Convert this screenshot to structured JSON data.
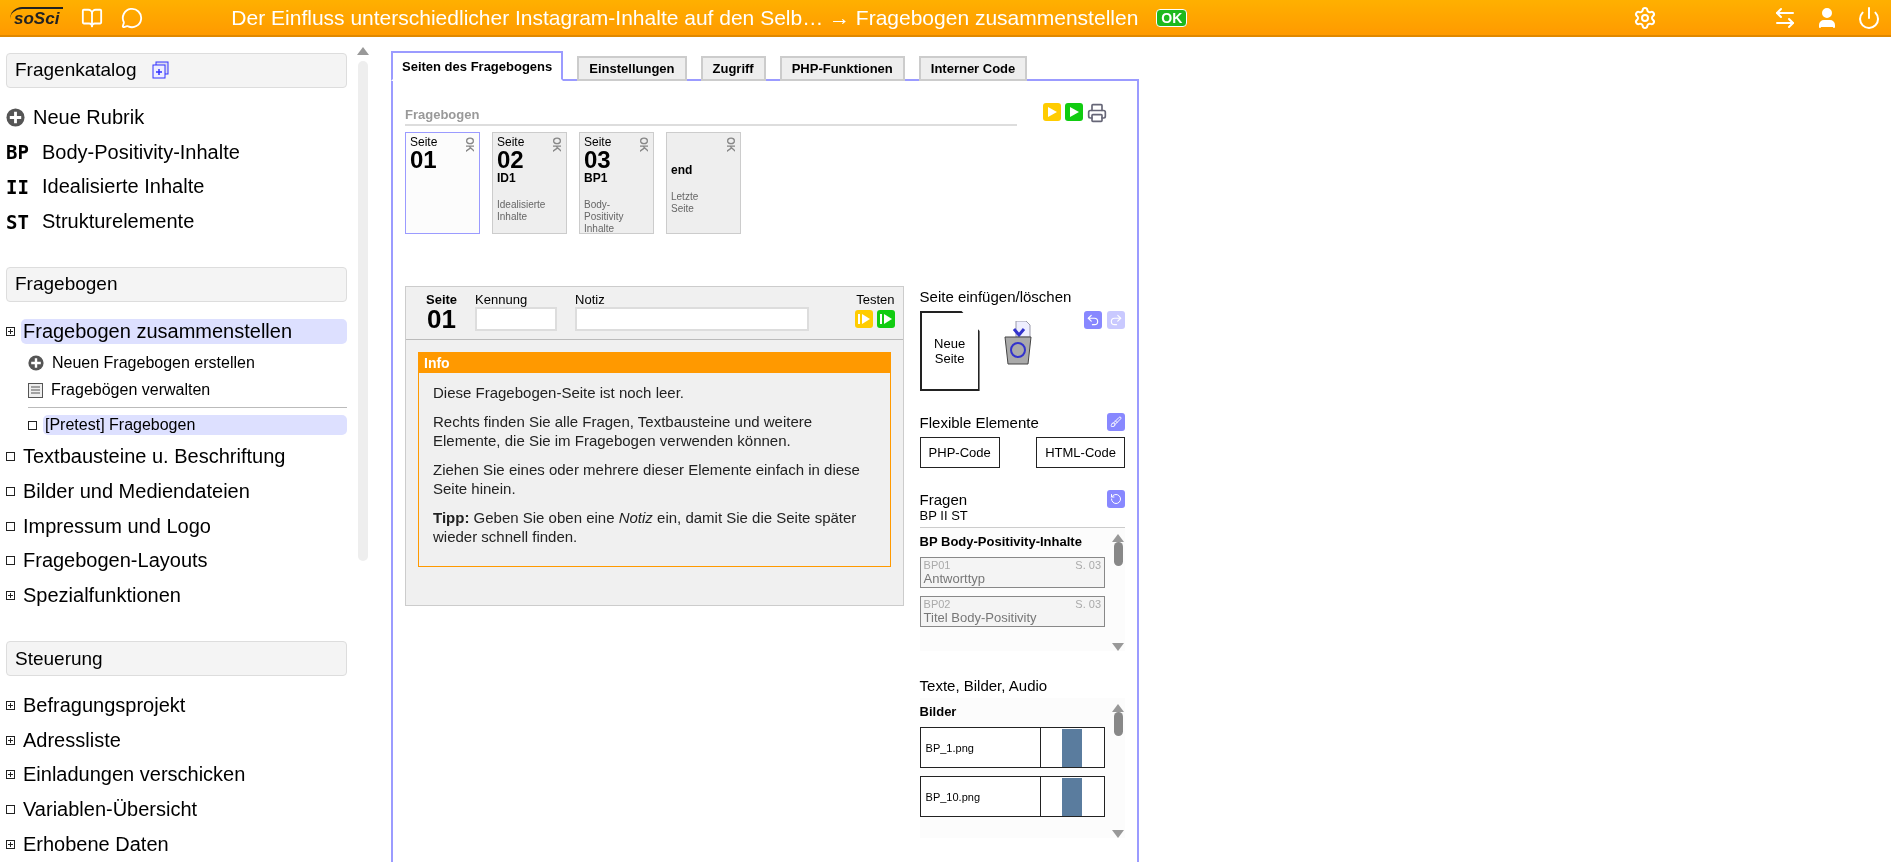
{
  "top_bar": {
    "logo": "soSci",
    "title": "Der Einfluss unterschiedlicher Instagram-Inhalte auf den Selb… → Fragebogen zusammenstellen",
    "status": "OK"
  },
  "sidebar": {
    "sections": [
      {
        "title": "Fragenkatalog",
        "items": [
          {
            "kind": "add",
            "label": "Neue Rubrik",
            "selected": false
          },
          {
            "kind": "rubric",
            "code": "BP",
            "label": "Body-Positivity-Inhalte",
            "selected": false
          },
          {
            "kind": "rubric",
            "code": "II",
            "label": "Idealisierte Inhalte",
            "selected": false
          },
          {
            "kind": "rubric",
            "code": "ST",
            "label": "Strukturelemente",
            "selected": false
          }
        ]
      },
      {
        "title": "Fragebogen",
        "items": [
          {
            "kind": "expandable",
            "label": "Fragebogen zusammenstellen",
            "selected": true,
            "children": [
              {
                "kind": "add",
                "label": "Neuen Fragebogen erstellen",
                "selected": false
              },
              {
                "kind": "list",
                "label": "Fragebögen verwalten",
                "selected": false
              }
            ],
            "questionnaires": [
              {
                "label": "[Pretest] Fragebogen",
                "selected": true
              }
            ]
          },
          {
            "kind": "leaf",
            "label": "Textbausteine u. Beschriftung",
            "selected": false
          },
          {
            "kind": "leaf",
            "label": "Bilder und Mediendateien",
            "selected": false
          },
          {
            "kind": "leaf",
            "label": "Impressum und Logo",
            "selected": false
          },
          {
            "kind": "leaf",
            "label": "Fragebogen-Layouts",
            "selected": false
          },
          {
            "kind": "expandable",
            "label": "Spezialfunktionen",
            "selected": false
          }
        ]
      },
      {
        "title": "Steuerung",
        "items": [
          {
            "kind": "expandable",
            "label": "Befragungsprojekt",
            "selected": false
          },
          {
            "kind": "expandable",
            "label": "Adressliste",
            "selected": false
          },
          {
            "kind": "expandable",
            "label": "Einladungen verschicken",
            "selected": false
          },
          {
            "kind": "leaf",
            "label": "Variablen-Übersicht",
            "selected": false
          },
          {
            "kind": "expandable",
            "label": "Erhobene Daten",
            "selected": false
          }
        ]
      }
    ]
  },
  "tabs": [
    {
      "label": "Seiten des Fragebogens",
      "selected": true
    },
    {
      "label": "Einstellungen",
      "selected": false
    },
    {
      "label": "Zugriff",
      "selected": false
    },
    {
      "label": "PHP-Funktionen",
      "selected": false
    },
    {
      "label": "Interner Code",
      "selected": false
    }
  ],
  "pages": {
    "title": "Fragebogen",
    "items": [
      {
        "kind": "page",
        "label": "Seite",
        "number": "01",
        "status": "OK",
        "selected": true
      },
      {
        "kind": "page",
        "label": "Seite",
        "number": "02",
        "code": "ID1",
        "description": "Idealisierte Inhalte",
        "status": "OK",
        "selected": false
      },
      {
        "kind": "page",
        "label": "Seite",
        "number": "03",
        "code": "BP1",
        "description": "Body-Positivity Inhalte",
        "status": "OK",
        "selected": false
      },
      {
        "kind": "end",
        "code": "end",
        "description": "Letzte Seite",
        "status": "OK",
        "selected": false
      }
    ]
  },
  "editor": {
    "page_label": "Seite",
    "page_number": "01",
    "fields": [
      {
        "label": "Kennung",
        "kind": "short"
      },
      {
        "label": "Notiz",
        "kind": "long"
      }
    ],
    "test_label": "Testen",
    "info": {
      "title": "Info",
      "paragraphs": [
        "Diese Fragebogen-Seite ist noch leer.",
        "Rechts finden Sie alle Fragen, Textbausteine und weitere Elemente, die Sie im Fragebogen verwenden können.",
        "Ziehen Sie eines oder mehrere dieser Elemente einfach in diese Seite hinein.",
        "**Tipp:** Geben Sie oben eine *Notiz* ein, damit Sie die Seite später wieder schnell finden."
      ]
    }
  },
  "insert_panel": {
    "title": "Seite einfügen/löschen",
    "new_page": "Neue Seite",
    "redo_disabled": true
  },
  "flexible": {
    "title": "Flexible Elemente",
    "buttons": [
      "PHP-Code",
      "HTML-Code"
    ]
  },
  "questions": {
    "title": "Fragen",
    "filter": "BP II ST",
    "group": "BP Body-Positivity-Inhalte",
    "items": [
      {
        "code": "BP01",
        "page": "S. 03",
        "title": "Antworttyp"
      },
      {
        "code": "BP02",
        "page": "S. 03",
        "title": "Titel Body-Positivity"
      }
    ]
  },
  "media": {
    "title": "Texte, Bilder, Audio",
    "group": "Bilder",
    "files": [
      {
        "name": "BP_1.png"
      },
      {
        "name": "BP_10.png"
      }
    ]
  }
}
